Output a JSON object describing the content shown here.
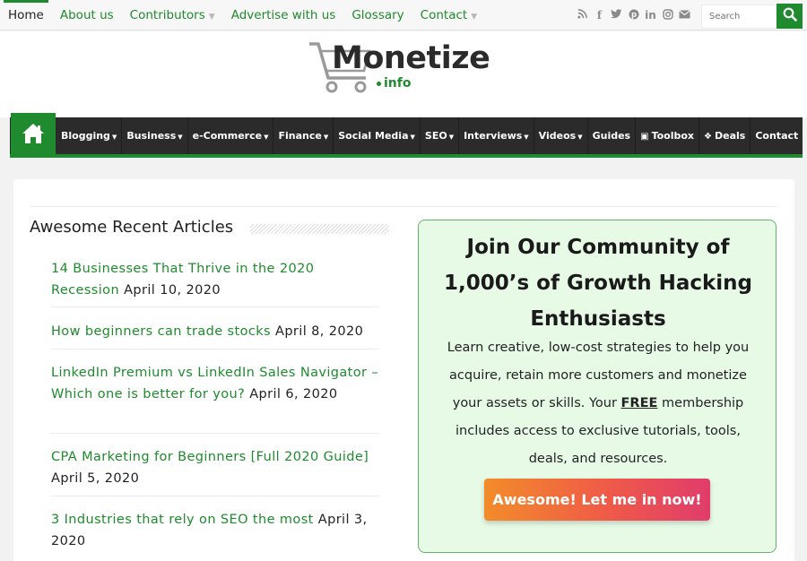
{
  "topbar": {
    "nav": [
      {
        "label": "Home",
        "active": true,
        "dropdown": false
      },
      {
        "label": "About us",
        "active": false,
        "dropdown": false
      },
      {
        "label": "Contributors",
        "active": false,
        "dropdown": true
      },
      {
        "label": "Advertise with us",
        "active": false,
        "dropdown": false
      },
      {
        "label": "Glossary",
        "active": false,
        "dropdown": false
      },
      {
        "label": "Contact",
        "active": false,
        "dropdown": true
      }
    ],
    "social_icons": [
      "rss-icon",
      "facebook-icon",
      "twitter-icon",
      "pinterest-icon",
      "linkedin-icon",
      "instagram-icon",
      "email-icon"
    ],
    "search": {
      "placeholder": "Search",
      "icon": "search-icon"
    }
  },
  "logo": {
    "main": "Monetize",
    "sub": "info",
    "icon": "shopping-cart-icon"
  },
  "main_nav": {
    "home_icon": "home-icon",
    "items": [
      {
        "label": "Blogging",
        "dropdown": true
      },
      {
        "label": "Business",
        "dropdown": true
      },
      {
        "label": "e-Commerce",
        "dropdown": true
      },
      {
        "label": "Finance",
        "dropdown": true
      },
      {
        "label": "Social Media",
        "dropdown": true
      },
      {
        "label": "SEO",
        "dropdown": true
      },
      {
        "label": "Interviews",
        "dropdown": true
      },
      {
        "label": "Videos",
        "dropdown": true
      },
      {
        "label": "Guides",
        "dropdown": false
      },
      {
        "label": "Toolbox",
        "dropdown": false,
        "icon": "briefcase-icon"
      },
      {
        "label": "Deals",
        "dropdown": false,
        "icon": "tag-icon"
      },
      {
        "label": "Contact",
        "dropdown": false
      }
    ]
  },
  "recent": {
    "title": "Awesome Recent Articles",
    "articles": [
      {
        "title": "14 Businesses That Thrive in the 2020 Recession",
        "date": "April 10, 2020"
      },
      {
        "title": "How beginners can trade stocks",
        "date": "April 8, 2020"
      },
      {
        "title": "LinkedIn Premium vs LinkedIn Sales Navigator – Which one is better for you?",
        "date": "April 6, 2020"
      },
      {
        "title": "CPA Marketing for Beginners [Full 2020 Guide]",
        "date": "April 5, 2020"
      },
      {
        "title": "3 Industries that rely on SEO the most",
        "date": "April 3, 2020"
      }
    ]
  },
  "cta": {
    "title_lines": [
      "Join Our Community of",
      "1,000’s of Growth Hacking",
      "Enthusiasts"
    ],
    "body_before": "Learn creative, low-cost strategies to help you acquire, retain more customers and monetize your assets or skills. Your ",
    "body_free": "FREE",
    "body_after": " membership includes access to exclusive tutorials, tools, deals, and resources.",
    "button": "Awesome! Let me in now!"
  },
  "colors": {
    "accent": "#1f8a2e",
    "nav_bg": "#2b2b2b",
    "cta_bg": "#e6fae6",
    "cta_border": "#66b26a",
    "button_start": "#f28c2a",
    "button_end": "#e03c6c"
  }
}
